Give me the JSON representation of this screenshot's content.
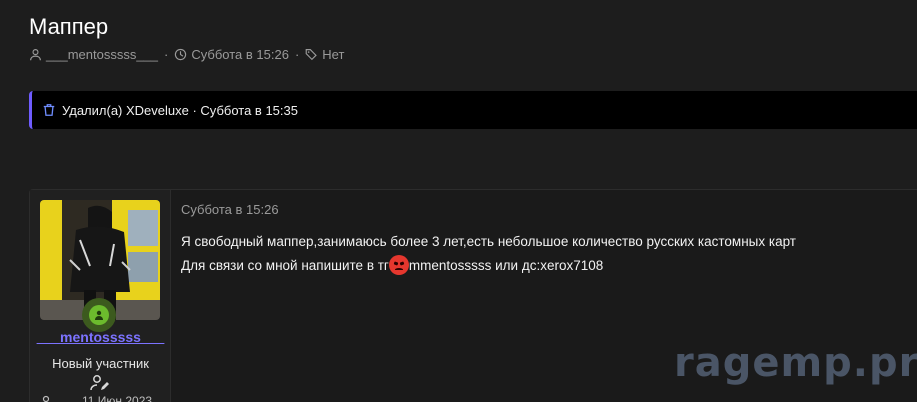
{
  "thread": {
    "title": "Маппер",
    "author": "___mentosssss___",
    "date": "Суббота в 15:26",
    "tags": "Нет"
  },
  "deleted_notice": {
    "text": "Удалил(а) XDeveluxe · Суббота в 15:35",
    "accent_color": "#6f5cff"
  },
  "post": {
    "date": "Суббота в 15:26",
    "line1": "Я свободный маппер,занимаюсь более 3 лет,есть небольшое количество русских кастомных карт",
    "line2_before_emoji": "Для связи со мной напишите в тг",
    "line2_after_emoji": "mmentosssss или дс:xerox7108",
    "emoji": "angry-face-emoji"
  },
  "user": {
    "username": "___mentosssss___",
    "user_title": "Новый участник",
    "joined": "11 Июн 2023",
    "status": "online",
    "username_color": "#7c73ff"
  },
  "watermark": "ragemp.pro"
}
